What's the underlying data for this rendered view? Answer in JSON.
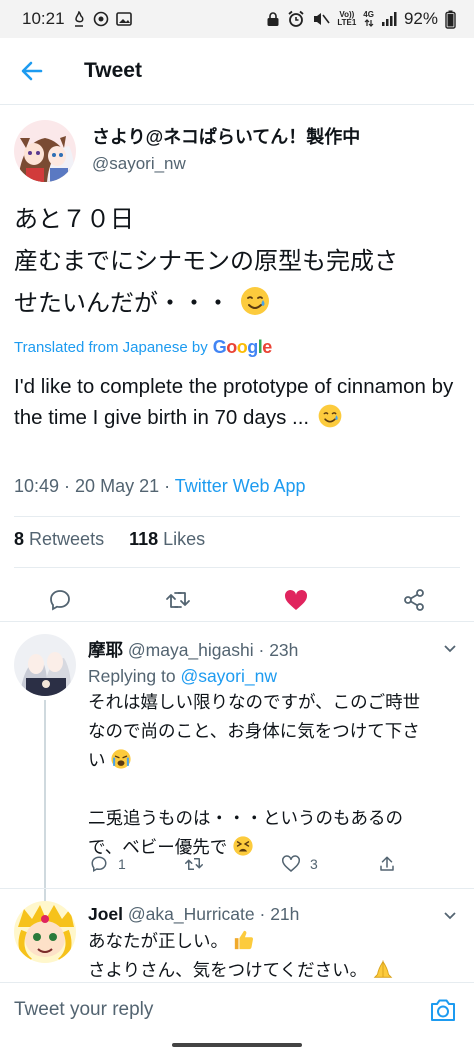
{
  "status_bar": {
    "time": "10:21",
    "network_top": "Vo))",
    "network_bottom": "LTE1",
    "network_type": "4G",
    "battery": "92%"
  },
  "header": {
    "title": "Tweet"
  },
  "tweet": {
    "author_name": "さより@ネコぱらいてん！製作中",
    "author_handle": "@sayori_nw",
    "text_lines": [
      "あと７０日",
      "産むまでにシナモンの原型も完成さ",
      "せたいんだが・・・"
    ],
    "translated_label": "Translated from Japanese by",
    "translated_provider": "Google",
    "translated_text": "I'd like to complete the prototype of cinnamon by the time I give birth in 70 days ...",
    "time": "10:49",
    "date": "20 May 21",
    "source": "Twitter Web App",
    "retweets_count": "8",
    "retweets_label": "Retweets",
    "likes_count": "118",
    "likes_label": "Likes",
    "liked_color": "#e0245e"
  },
  "replies": [
    {
      "name": "摩耶",
      "handle": "@maya_higashi",
      "age": "23h",
      "replying_label": "Replying to",
      "replying_to": "@sayori_nw",
      "body_lines": [
        "それは嬉しい限りなのですが、このご時世",
        "なので尚のこと、お身体に気をつけて下さ",
        "い",
        "",
        "二兎追うものは・・・というのもあるの",
        "で、ベビー優先で"
      ],
      "reply_count": "1",
      "like_count": "3"
    },
    {
      "name": "Joel",
      "handle": "@aka_Hurricate",
      "age": "21h",
      "body_lines": [
        "あなたが正しい。",
        "さよりさん、気をつけてください。"
      ]
    }
  ],
  "compose": {
    "placeholder": "Tweet your reply"
  },
  "colors": {
    "accent": "#1d9bf0",
    "text": "#0f1419",
    "secondary": "#536471"
  }
}
